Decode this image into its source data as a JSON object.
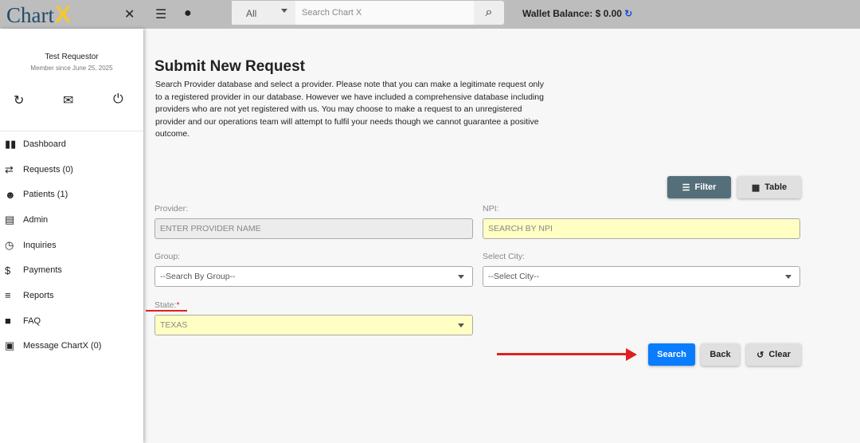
{
  "header": {
    "logo_text": "Chart",
    "logo_x": "X",
    "search_scope": "All",
    "search_placeholder": "Search Chart X",
    "wallet": "Wallet Balance: $ 0.00"
  },
  "user": {
    "name": "Test Requestor",
    "member_since": "Member since June 25, 2025"
  },
  "nav": [
    {
      "label": "Dashboard",
      "icon": "▮▮"
    },
    {
      "label": "Requests (0)",
      "icon": "⇄"
    },
    {
      "label": "Patients (1)",
      "icon": "☻"
    },
    {
      "label": "Admin",
      "icon": "▤"
    },
    {
      "label": "Inquiries",
      "icon": "◷"
    },
    {
      "label": "Payments",
      "icon": "$"
    },
    {
      "label": "Reports",
      "icon": "≡"
    },
    {
      "label": "FAQ",
      "icon": "■"
    },
    {
      "label": "Message ChartX (0)",
      "icon": "▣"
    }
  ],
  "page": {
    "title": "Submit New Request",
    "description": "Search Provider database and select a provider. Please note that you can make a legitimate request only to a registered provider in our database. However we have included a comprehensive database including providers who are not yet registered with us. You may choose to make a request to an unregistered provider and our operations team will attempt to fulfil your needs though we cannot guarantee a positive outcome."
  },
  "buttons": {
    "filter": "Filter",
    "table": "Table",
    "search": "Search",
    "back": "Back",
    "clear": "Clear"
  },
  "form": {
    "provider_label": "Provider:",
    "provider_placeholder": "ENTER PROVIDER NAME",
    "npi_label": "NPI:",
    "npi_placeholder": "SEARCH BY NPI",
    "group_label": "Group:",
    "group_value": "--Search By Group--",
    "city_label": "Select City:",
    "city_value": "--Select City--",
    "state_label": "State:",
    "state_required": "*",
    "state_value": "TEXAS"
  }
}
